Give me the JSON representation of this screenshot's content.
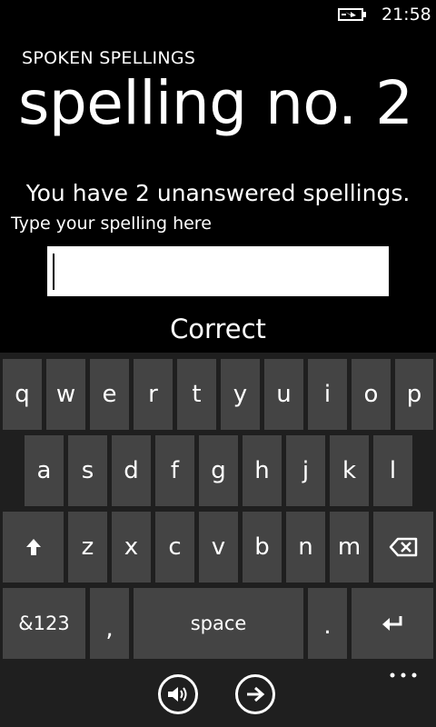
{
  "status_bar": {
    "time": "21:58",
    "battery_icon": "battery-charging-icon"
  },
  "header": {
    "app_title": "SPOKEN SPELLINGS",
    "page_title": "spelling no. 2"
  },
  "main": {
    "unanswered_text": "You have 2 unanswered spellings.",
    "field_label": "Type your spelling here",
    "input_value": "",
    "result_text": "Correct"
  },
  "keyboard": {
    "row1": [
      "q",
      "w",
      "e",
      "r",
      "t",
      "y",
      "u",
      "i",
      "o",
      "p"
    ],
    "row2": [
      "a",
      "s",
      "d",
      "f",
      "g",
      "h",
      "j",
      "k",
      "l"
    ],
    "row3": [
      "z",
      "x",
      "c",
      "v",
      "b",
      "n",
      "m"
    ],
    "shift_icon": "shift-arrow-icon",
    "backspace_icon": "backspace-icon",
    "symbols_label": "&123",
    "comma_label": ",",
    "space_label": "space",
    "period_label": ".",
    "enter_icon": "enter-icon"
  },
  "app_bar": {
    "buttons": [
      "speaker-icon",
      "next-arrow-icon"
    ],
    "more_icon": "more-dots-icon"
  }
}
